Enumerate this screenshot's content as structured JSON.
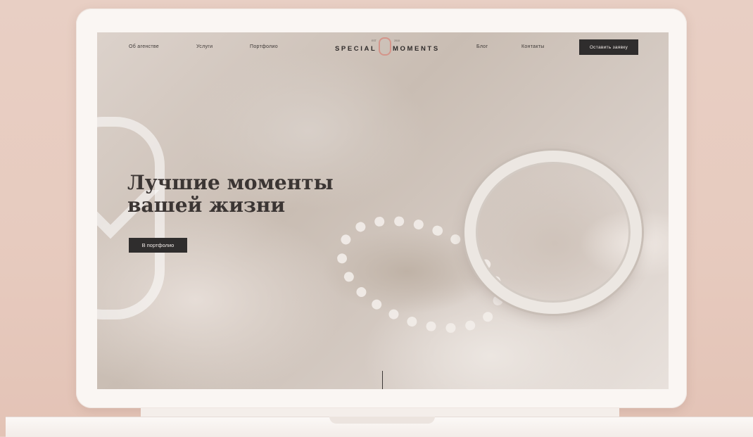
{
  "nav": {
    "items": [
      "Об агенстве",
      "Услуги",
      "Портфолио",
      "Блог",
      "Контакты"
    ],
    "cta_label": "Оставить заявку"
  },
  "logo": {
    "left_word": "SPECIAL",
    "right_word": "MOMENTS",
    "est_label": "EST",
    "year_label": "2018",
    "mark_color": "#d4958a"
  },
  "hero": {
    "title_line1": "Лучшие моменты",
    "title_line2": "вашей жизни",
    "button_label": "В портфолио"
  },
  "colors": {
    "accent": "#d4958a",
    "dark": "#2f2d2d",
    "background": "#e8cfc4"
  }
}
